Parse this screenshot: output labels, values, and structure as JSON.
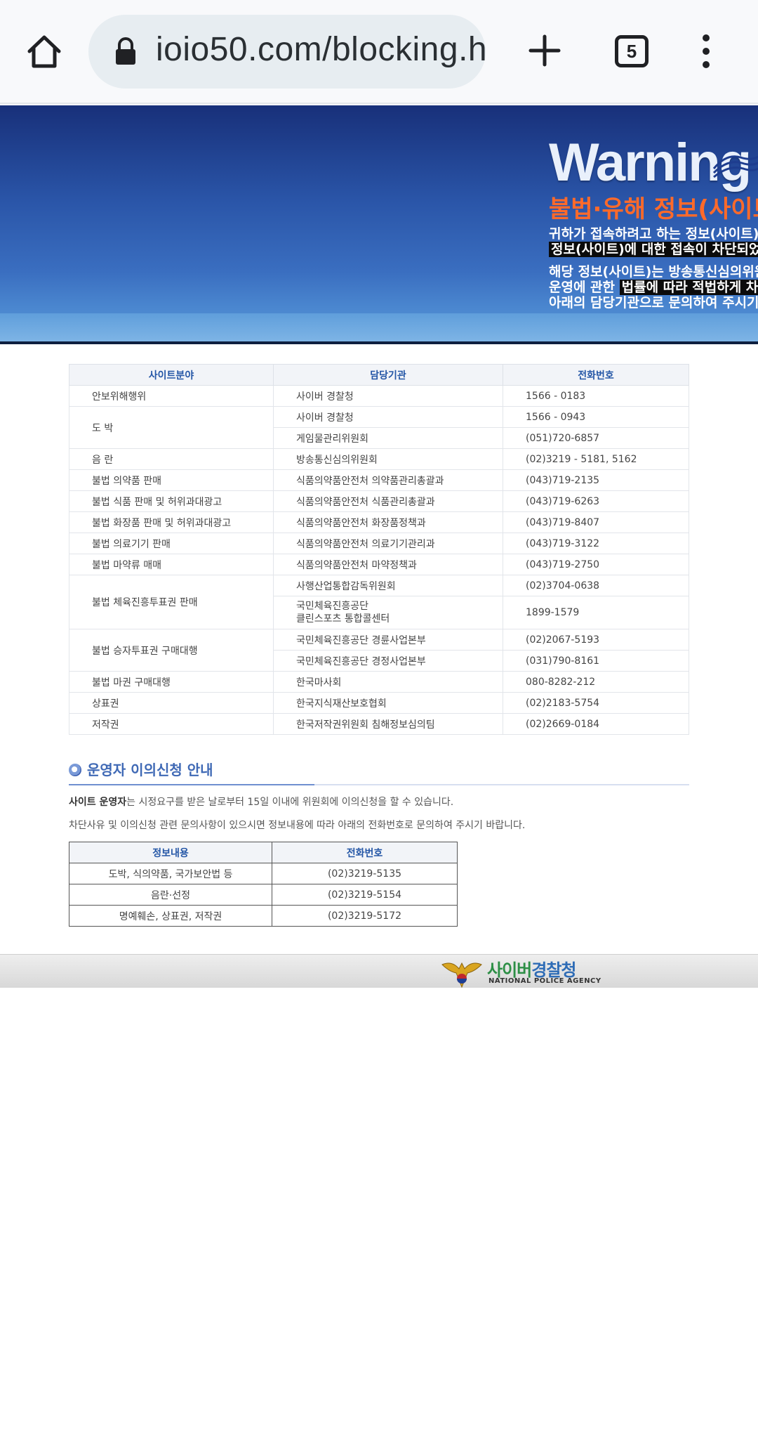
{
  "browser": {
    "url": "ioio50.com/blocking.h",
    "tab_count": "5"
  },
  "banner": {
    "title": "Warning",
    "subtitle": "불법·유해 정보(사이트",
    "line1": "귀하가 접속하려고 하는 정보(사이트)",
    "line2": "정보(사이트)에 대한 접속이 차단되었",
    "line3": "해당 정보(사이트)는 방송통신심의위원",
    "line4_pre": "운영에 관한 ",
    "line4_hl": "법률에 따라 적법하게 차단",
    "line5": "아래의 담당기관으로  문의하여 주시기"
  },
  "main_table": {
    "headers": [
      "사이트분야",
      "담당기관",
      "전화번호"
    ],
    "rows": [
      {
        "field": "안보위해행위",
        "agency": "사이버 경찰청",
        "phone": "1566 - 0183"
      },
      {
        "field": "도 박",
        "agency": "사이버 경찰청",
        "phone": "1566 - 0943"
      },
      {
        "field": "",
        "agency": "게임물관리위원회",
        "phone": "(051)720-6857"
      },
      {
        "field": "음 란",
        "agency": "방송통신심의위원회",
        "phone": "(02)3219 - 5181, 5162"
      },
      {
        "field": "불법 의약품 판매",
        "agency": "식품의약품안전처 의약품관리총괄과",
        "phone": "(043)719-2135"
      },
      {
        "field": "불법 식품 판매 및 허위과대광고",
        "agency": "식품의약품안전처 식품관리총괄과",
        "phone": "(043)719-6263"
      },
      {
        "field": "불법 화장품 판매 및 허위과대광고",
        "agency": "식품의약품안전처 화장품정책과",
        "phone": "(043)719-8407"
      },
      {
        "field": "불법 의료기기 판매",
        "agency": "식품의약품안전처 의료기기관리과",
        "phone": "(043)719-3122"
      },
      {
        "field": "불법 마약류 매매",
        "agency": "식품의약품안전처 마약정책과",
        "phone": "(043)719-2750"
      },
      {
        "field": "불법 체육진흥투표권 판매",
        "agency": "사행산업통합감독위원회",
        "phone": "(02)3704-0638"
      },
      {
        "field": "",
        "agency": "국민체육진흥공단",
        "agency2": "클린스포츠 통합콜센터",
        "phone": "1899-1579"
      },
      {
        "field": "불법 승자투표권 구매대행",
        "agency": "국민체육진흥공단 경륜사업본부",
        "phone": "(02)2067-5193"
      },
      {
        "field": "",
        "agency": "국민체육진흥공단 경정사업본부",
        "phone": "(031)790-8161"
      },
      {
        "field": "불법 마권 구매대행",
        "agency": "한국마사회",
        "phone": "080-8282-212"
      },
      {
        "field": "상표권",
        "agency": "한국지식재산보호협회",
        "phone": "(02)2183-5754"
      },
      {
        "field": "저작권",
        "agency": "한국저작권위원회 침해정보심의팀",
        "phone": "(02)2669-0184"
      }
    ]
  },
  "section": {
    "title": "운영자 이의신청 안내",
    "p1_bold": "사이트 운영자",
    "p1_rest": "는 시정요구를 받은 날로부터 15일 이내에 위원회에 이의신청을 할 수 있습니다.",
    "p2": "차단사유 및 이의신청 관련 문의사항이 있으시면 정보내용에 따라 아래의 전화번호로 문의하여 주시기 바랍니다."
  },
  "info_table": {
    "headers": [
      "정보내용",
      "전화번호"
    ],
    "rows": [
      {
        "content": "도박, 식의약품, 국가보안법 등",
        "phone": "(02)3219-5135"
      },
      {
        "content": "음란·선정",
        "phone": "(02)3219-5154"
      },
      {
        "content": "명예훼손, 상표권, 저작권",
        "phone": "(02)3219-5172"
      }
    ]
  },
  "footer": {
    "name_green": "사이버",
    "name_blue": "경찰청",
    "sub": "NATIONAL POLICE AGENCY"
  },
  "colors": {
    "accent_blue": "#2456a6",
    "warning_orange": "#ff6a2a"
  }
}
